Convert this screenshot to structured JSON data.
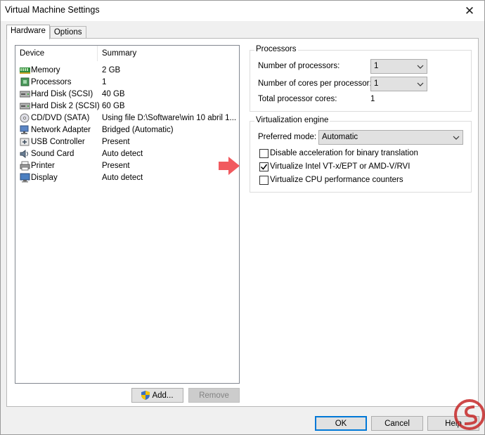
{
  "window": {
    "title": "Virtual Machine Settings",
    "close_label": "✕"
  },
  "tabs": [
    {
      "label": "Hardware",
      "active": true
    },
    {
      "label": "Options",
      "active": false
    }
  ],
  "device_list": {
    "headers": {
      "device": "Device",
      "summary": "Summary"
    },
    "rows": [
      {
        "device": "Memory",
        "summary": "2 GB",
        "icon": "memory-icon"
      },
      {
        "device": "Processors",
        "summary": "1",
        "icon": "processor-icon"
      },
      {
        "device": "Hard Disk (SCSI)",
        "summary": "40 GB",
        "icon": "hard-disk-icon"
      },
      {
        "device": "Hard Disk 2 (SCSI)",
        "summary": "60 GB",
        "icon": "hard-disk-icon"
      },
      {
        "device": "CD/DVD (SATA)",
        "summary": "Using file D:\\Software\\win 10 abril 1...",
        "icon": "cd-dvd-icon"
      },
      {
        "device": "Network Adapter",
        "summary": "Bridged (Automatic)",
        "icon": "network-adapter-icon"
      },
      {
        "device": "USB Controller",
        "summary": "Present",
        "icon": "usb-icon"
      },
      {
        "device": "Sound Card",
        "summary": "Auto detect",
        "icon": "sound-card-icon"
      },
      {
        "device": "Printer",
        "summary": "Present",
        "icon": "printer-icon"
      },
      {
        "device": "Display",
        "summary": "Auto detect",
        "icon": "display-icon"
      }
    ],
    "add_label": "Add...",
    "remove_label": "Remove"
  },
  "processors": {
    "group_title": "Processors",
    "num_processors_label": "Number of processors:",
    "num_processors_value": "1",
    "cores_label": "Number of cores per processor:",
    "cores_value": "1",
    "total_label": "Total processor cores:",
    "total_value": "1"
  },
  "virtualization": {
    "group_title": "Virtualization engine",
    "preferred_label": "Preferred mode:",
    "preferred_value": "Automatic",
    "options": [
      {
        "label": "Disable acceleration for binary translation",
        "checked": false
      },
      {
        "label": "Virtualize Intel VT-x/EPT or AMD-V/RVI",
        "checked": true
      },
      {
        "label": "Virtualize CPU performance counters",
        "checked": false
      }
    ]
  },
  "footer": {
    "ok_label": "OK",
    "cancel_label": "Cancel",
    "help_label": "Help"
  },
  "colors": {
    "accent": "#0078d7",
    "arrow": "#f15a5f",
    "watermark": "#c62828"
  }
}
